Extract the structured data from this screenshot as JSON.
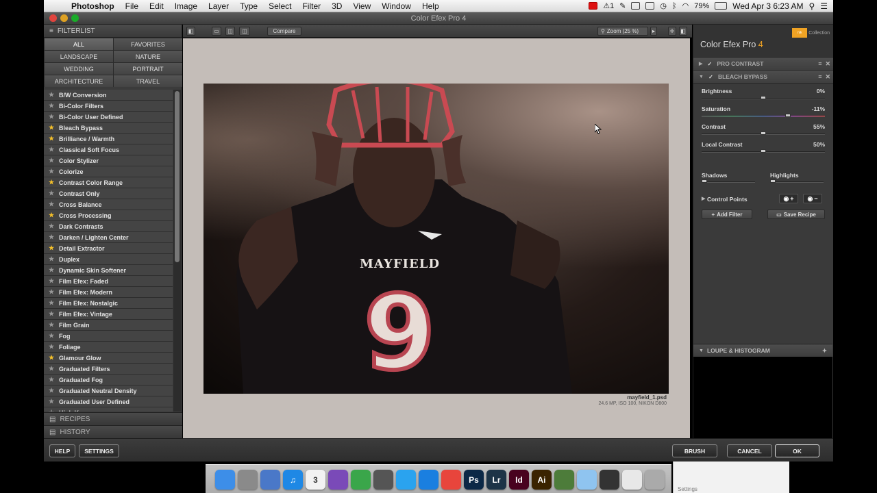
{
  "menubar": {
    "app": "Photoshop",
    "items": [
      "File",
      "Edit",
      "Image",
      "Layer",
      "Type",
      "Select",
      "Filter",
      "3D",
      "View",
      "Window",
      "Help"
    ],
    "status_count": "1",
    "battery": "79%",
    "clock": "Wed Apr 3  6:23 AM"
  },
  "window": {
    "title": "Color Efex Pro 4"
  },
  "left": {
    "header": "FILTERLIST",
    "categories": [
      "ALL",
      "FAVORITES",
      "LANDSCAPE",
      "NATURE",
      "WEDDING",
      "PORTRAIT",
      "ARCHITECTURE",
      "TRAVEL"
    ],
    "active_category": "ALL",
    "filters": [
      {
        "name": "B/W Conversion",
        "fav": false
      },
      {
        "name": "Bi-Color Filters",
        "fav": false
      },
      {
        "name": "Bi-Color User Defined",
        "fav": false
      },
      {
        "name": "Bleach Bypass",
        "fav": true
      },
      {
        "name": "Brilliance / Warmth",
        "fav": true
      },
      {
        "name": "Classical Soft Focus",
        "fav": false
      },
      {
        "name": "Color Stylizer",
        "fav": false
      },
      {
        "name": "Colorize",
        "fav": false
      },
      {
        "name": "Contrast Color Range",
        "fav": true
      },
      {
        "name": "Contrast Only",
        "fav": false
      },
      {
        "name": "Cross Balance",
        "fav": false
      },
      {
        "name": "Cross Processing",
        "fav": true
      },
      {
        "name": "Dark Contrasts",
        "fav": false
      },
      {
        "name": "Darken / Lighten Center",
        "fav": false
      },
      {
        "name": "Detail Extractor",
        "fav": true
      },
      {
        "name": "Duplex",
        "fav": false
      },
      {
        "name": "Dynamic Skin Softener",
        "fav": false
      },
      {
        "name": "Film Efex: Faded",
        "fav": false
      },
      {
        "name": "Film Efex: Modern",
        "fav": false
      },
      {
        "name": "Film Efex: Nostalgic",
        "fav": false
      },
      {
        "name": "Film Efex: Vintage",
        "fav": false
      },
      {
        "name": "Film Grain",
        "fav": false
      },
      {
        "name": "Fog",
        "fav": false
      },
      {
        "name": "Foliage",
        "fav": false
      },
      {
        "name": "Glamour Glow",
        "fav": true
      },
      {
        "name": "Graduated Filters",
        "fav": false
      },
      {
        "name": "Graduated Fog",
        "fav": false
      },
      {
        "name": "Graduated Neutral Density",
        "fav": false
      },
      {
        "name": "Graduated User Defined",
        "fav": false
      },
      {
        "name": "High Key",
        "fav": false
      }
    ],
    "recipes": "RECIPES",
    "history": "HISTORY"
  },
  "toolbar": {
    "compare": "Compare",
    "zoom": "Zoom (25 %)"
  },
  "image": {
    "filename": "mayfield_1.psd",
    "meta": "24.6 MP, ISO 100, NIKON D800",
    "jersey_text": "MAYFIELD",
    "jersey_number": "9"
  },
  "right": {
    "brand": "Color Efex Pro",
    "brand_version": "4",
    "collection": "Collection",
    "filters": [
      {
        "name": "PRO CONTRAST",
        "expanded": false
      },
      {
        "name": "BLEACH BYPASS",
        "expanded": true
      }
    ],
    "sliders": [
      {
        "label": "Brightness",
        "value": "0%",
        "pos": 0.5
      },
      {
        "label": "Saturation",
        "value": "-11%",
        "pos": 0.7
      },
      {
        "label": "Contrast",
        "value": "55%",
        "pos": 0.5
      },
      {
        "label": "Local Contrast",
        "value": "50%",
        "pos": 0.5
      }
    ],
    "shadows": "Shadows",
    "highlights": "Highlights",
    "control_points": "Control Points",
    "add_filter": "Add Filter",
    "save_recipe": "Save Recipe",
    "loupe": "LOUPE & HISTOGRAM"
  },
  "bottom": {
    "help": "HELP",
    "settings": "SETTINGS",
    "brush": "BRUSH",
    "cancel": "CANCEL",
    "ok": "OK"
  },
  "dock": {
    "apps": [
      {
        "name": "finder-icon",
        "label": "",
        "color": "#3d8ee8"
      },
      {
        "name": "preview-icon",
        "label": "",
        "color": "#8a8a8a"
      },
      {
        "name": "textedit-icon",
        "label": "",
        "color": "#4a78c8"
      },
      {
        "name": "itunes-icon",
        "label": "♫",
        "color": "#1e88e5"
      },
      {
        "name": "calendar-icon",
        "label": "3",
        "color": "#f2f2f2"
      },
      {
        "name": "quill-icon",
        "label": "",
        "color": "#7a4ab8"
      },
      {
        "name": "evernote-icon",
        "label": "",
        "color": "#3aa64a"
      },
      {
        "name": "sharing-icon",
        "label": "",
        "color": "#555"
      },
      {
        "name": "twitter-icon",
        "label": "",
        "color": "#2aa3ef"
      },
      {
        "name": "safari-icon",
        "label": "",
        "color": "#1a7fe0"
      },
      {
        "name": "chrome-icon",
        "label": "",
        "color": "#e8453c"
      },
      {
        "name": "photoshop-icon",
        "label": "Ps",
        "color": "#0b2846"
      },
      {
        "name": "lightroom-icon",
        "label": "Lr",
        "color": "#1d3447"
      },
      {
        "name": "indesign-icon",
        "label": "Id",
        "color": "#49021f"
      },
      {
        "name": "illustrator-icon",
        "label": "Ai",
        "color": "#3a2300"
      },
      {
        "name": "script-icon",
        "label": "",
        "color": "#4d7c3a"
      },
      {
        "name": "folder-icon",
        "label": "",
        "color": "#8fc4f0"
      },
      {
        "name": "display-icon",
        "label": "",
        "color": "#333"
      },
      {
        "name": "mail-icon",
        "label": "",
        "color": "#e8e8e8"
      },
      {
        "name": "trash-icon",
        "label": "",
        "color": "#aaa"
      }
    ],
    "settings_caption": "Settings"
  }
}
